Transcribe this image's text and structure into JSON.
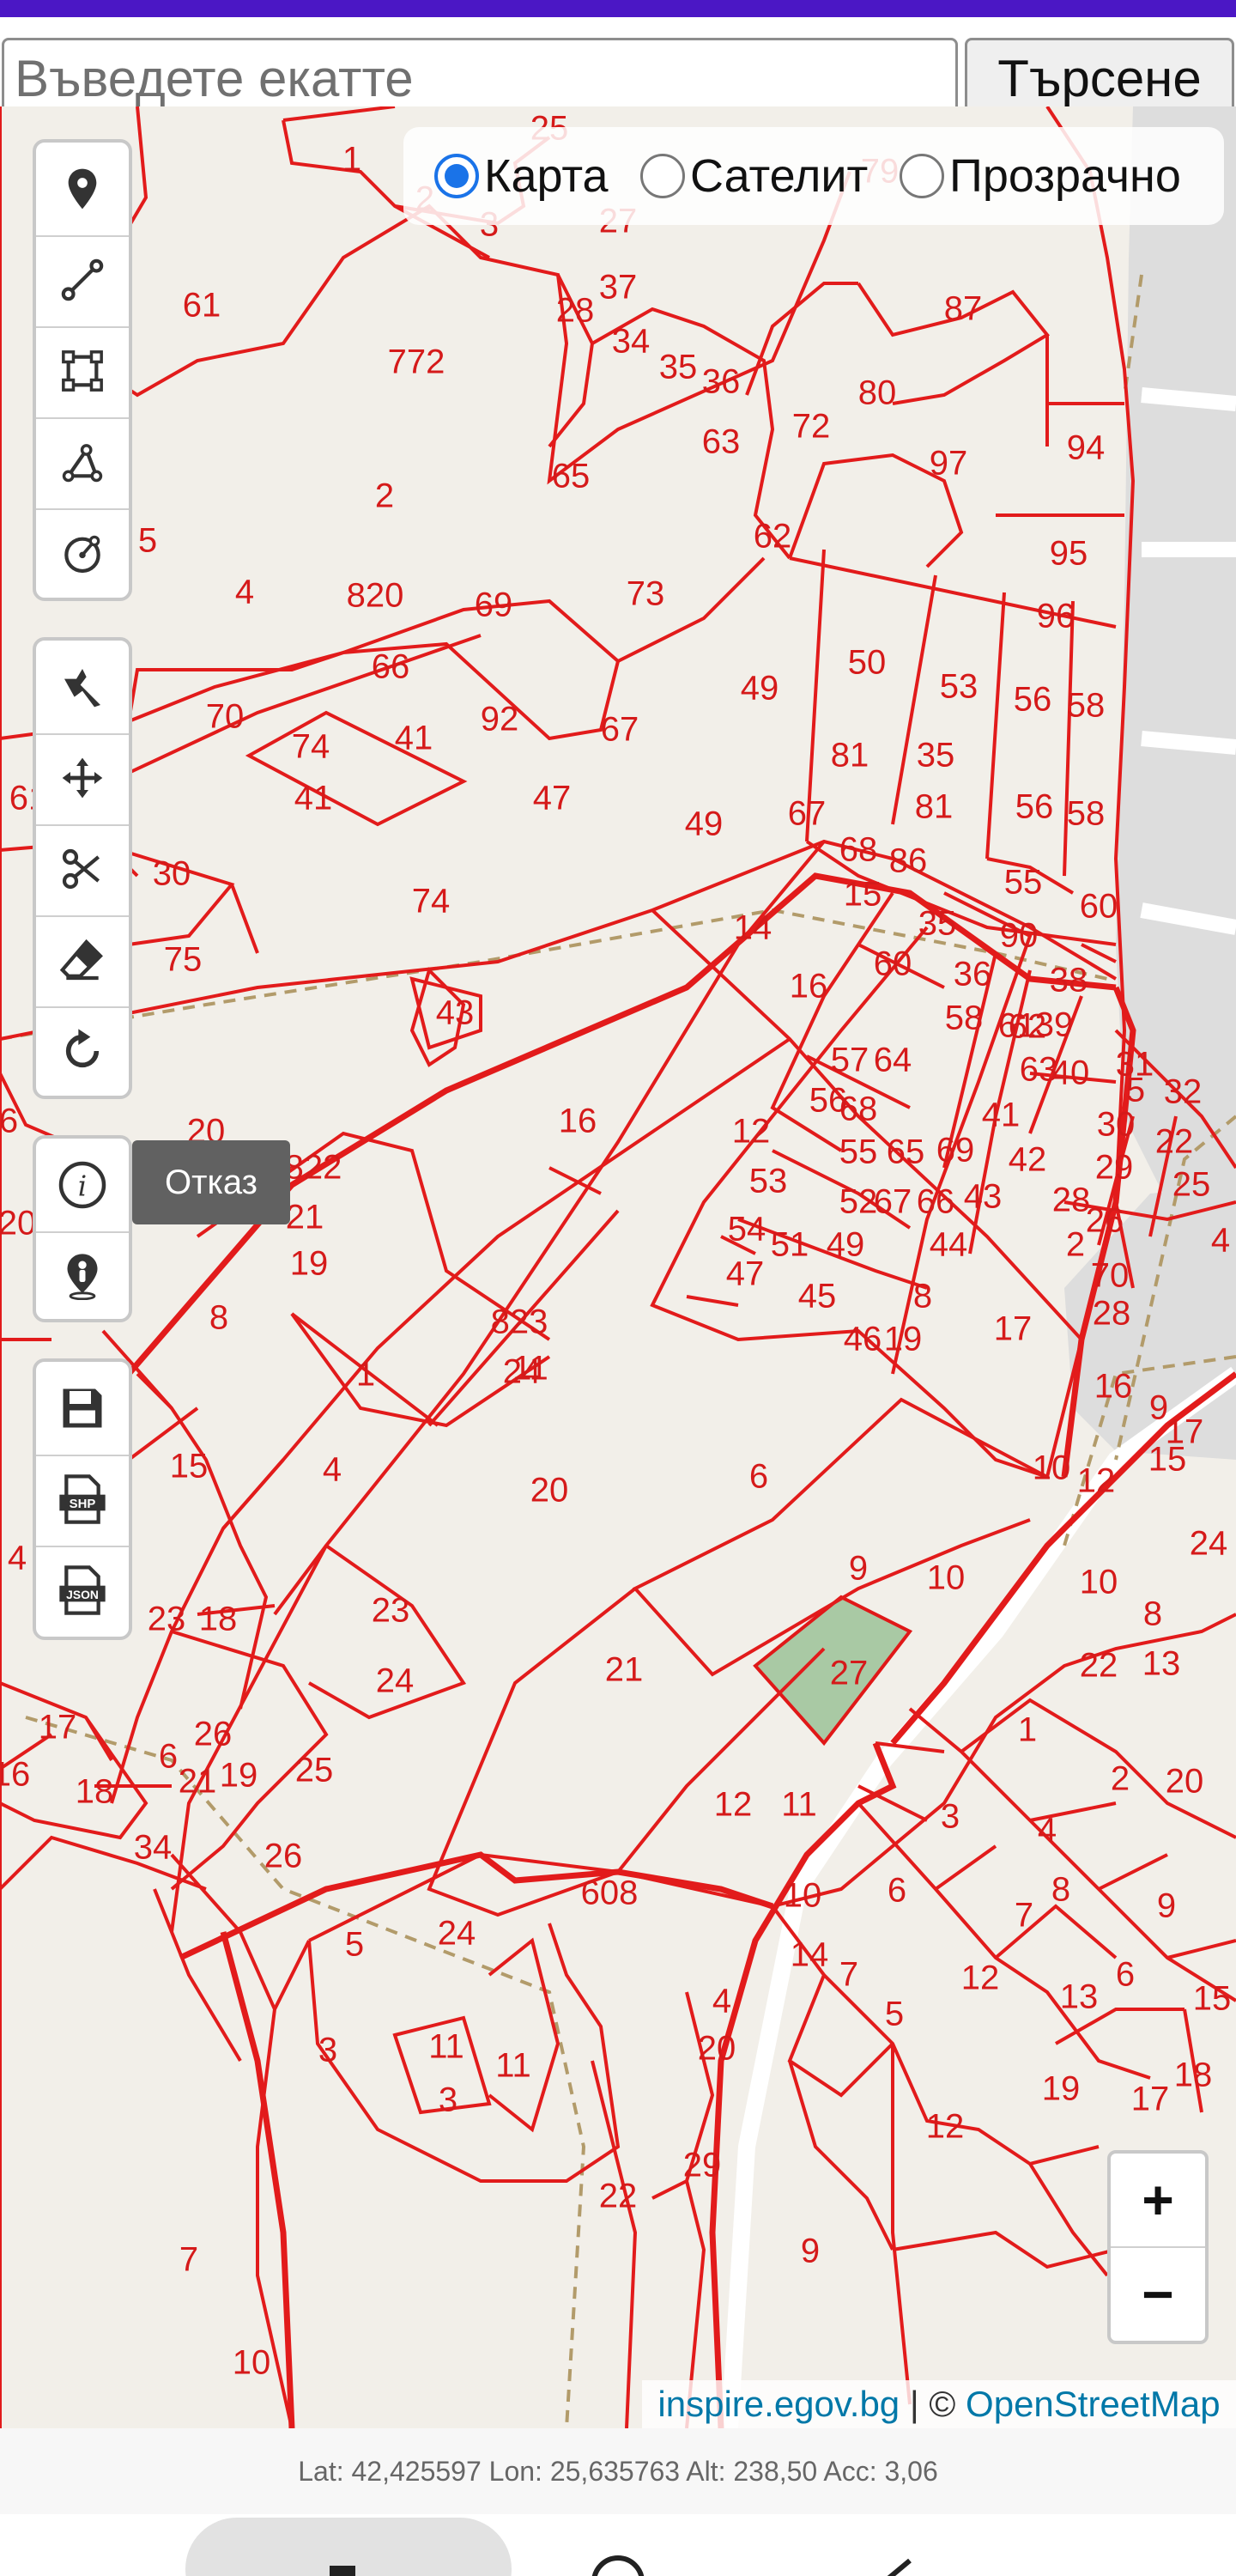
{
  "search": {
    "placeholder": "Въведете екатте",
    "button_label": "Търсене"
  },
  "layers": {
    "options": [
      "Карта",
      "Сателит",
      "Прозрачно"
    ],
    "selected": "Карта"
  },
  "tools": {
    "group1": [
      "marker-icon",
      "line-icon",
      "rectangle-icon",
      "polygon-icon",
      "circle-icon"
    ],
    "group2": [
      "select-edit-icon",
      "move-icon",
      "cut-icon",
      "eraser-icon",
      "rotate-icon"
    ],
    "group3": [
      "info-icon",
      "location-person-icon"
    ],
    "group4": [
      "save-icon",
      "shp-export-icon",
      "json-export-icon"
    ],
    "shp_label": "SHP",
    "json_label": "JSON"
  },
  "tooltip": "Отказ",
  "attribution": {
    "site": "inspire.egov.bg",
    "separator": " | © ",
    "osm": "OpenStreetMap"
  },
  "zoom": {
    "in": "+",
    "out": "−"
  },
  "gps": "Lat: 42,425597 Lon: 25,635763 Alt: 238,50 Acc: 3,06",
  "map": {
    "parcel_labels": [
      "25",
      "1",
      "2",
      "3",
      "27",
      "79",
      "37",
      "28",
      "34",
      "35",
      "36",
      "87",
      "80",
      "72",
      "97",
      "94",
      "61",
      "772",
      "63",
      "65",
      "2",
      "62",
      "95",
      "5",
      "4",
      "820",
      "69",
      "73",
      "96",
      "66",
      "49",
      "50",
      "53",
      "56",
      "58",
      "70",
      "74",
      "41",
      "92",
      "67",
      "81",
      "35",
      "41",
      "47",
      "49",
      "67",
      "81",
      "56",
      "58",
      "61",
      "30",
      "74",
      "68",
      "86",
      "15",
      "55",
      "60",
      "14",
      "35",
      "90",
      "75",
      "43",
      "16",
      "60",
      "36",
      "38",
      "58",
      "62",
      "61",
      "39",
      "57",
      "64",
      "63",
      "40",
      "5",
      "31",
      "32",
      "6",
      "16",
      "12",
      "56",
      "68",
      "41",
      "30",
      "22",
      "20",
      "822",
      "55",
      "65",
      "69",
      "42",
      "29",
      "25",
      "20",
      "21",
      "53",
      "52",
      "67",
      "66",
      "43",
      "28",
      "26",
      "4",
      "19",
      "54",
      "51",
      "49",
      "44",
      "2",
      "70",
      "47",
      "45",
      "8",
      "823",
      "8",
      "24",
      "46",
      "19",
      "17",
      "28",
      "15",
      "11",
      "4",
      "1",
      "16",
      "9",
      "17",
      "15",
      "20",
      "6",
      "10",
      "12",
      "24",
      "9",
      "10",
      "10",
      "4",
      "23",
      "23",
      "18",
      "8",
      "21",
      "27",
      "22",
      "13",
      "24",
      "1",
      "17",
      "26",
      "25",
      "2",
      "20",
      "6",
      "16",
      "18",
      "19",
      "21",
      "12",
      "11",
      "3",
      "4",
      "34",
      "26",
      "10",
      "6",
      "8",
      "7",
      "9",
      "608",
      "24",
      "5",
      "14",
      "7",
      "6",
      "5",
      "12",
      "13",
      "15",
      "4",
      "3",
      "11",
      "11",
      "3",
      "20",
      "18",
      "19",
      "17",
      "12",
      "22",
      "29",
      "7",
      "9",
      "10"
    ]
  }
}
